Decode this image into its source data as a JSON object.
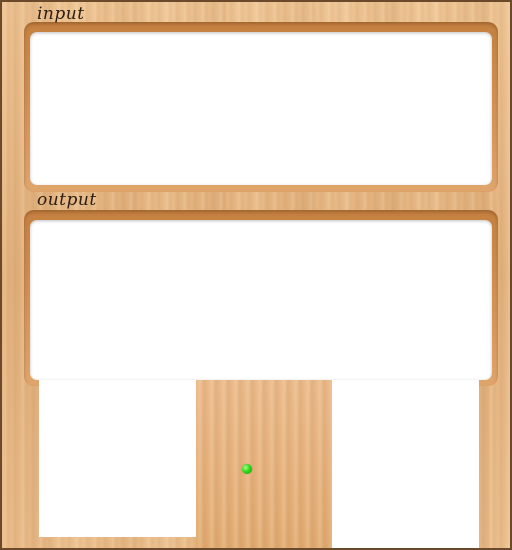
{
  "labels": {
    "input": "input",
    "output": "output"
  },
  "input": {
    "value": ""
  },
  "output": {
    "value": ""
  },
  "colors": {
    "wood": "#e7b987",
    "frame_border": "#6b4a2b",
    "panel": "#ffffff",
    "indicator": "#2bdc1a"
  },
  "icons": {
    "indicator": "green-dot-icon"
  }
}
